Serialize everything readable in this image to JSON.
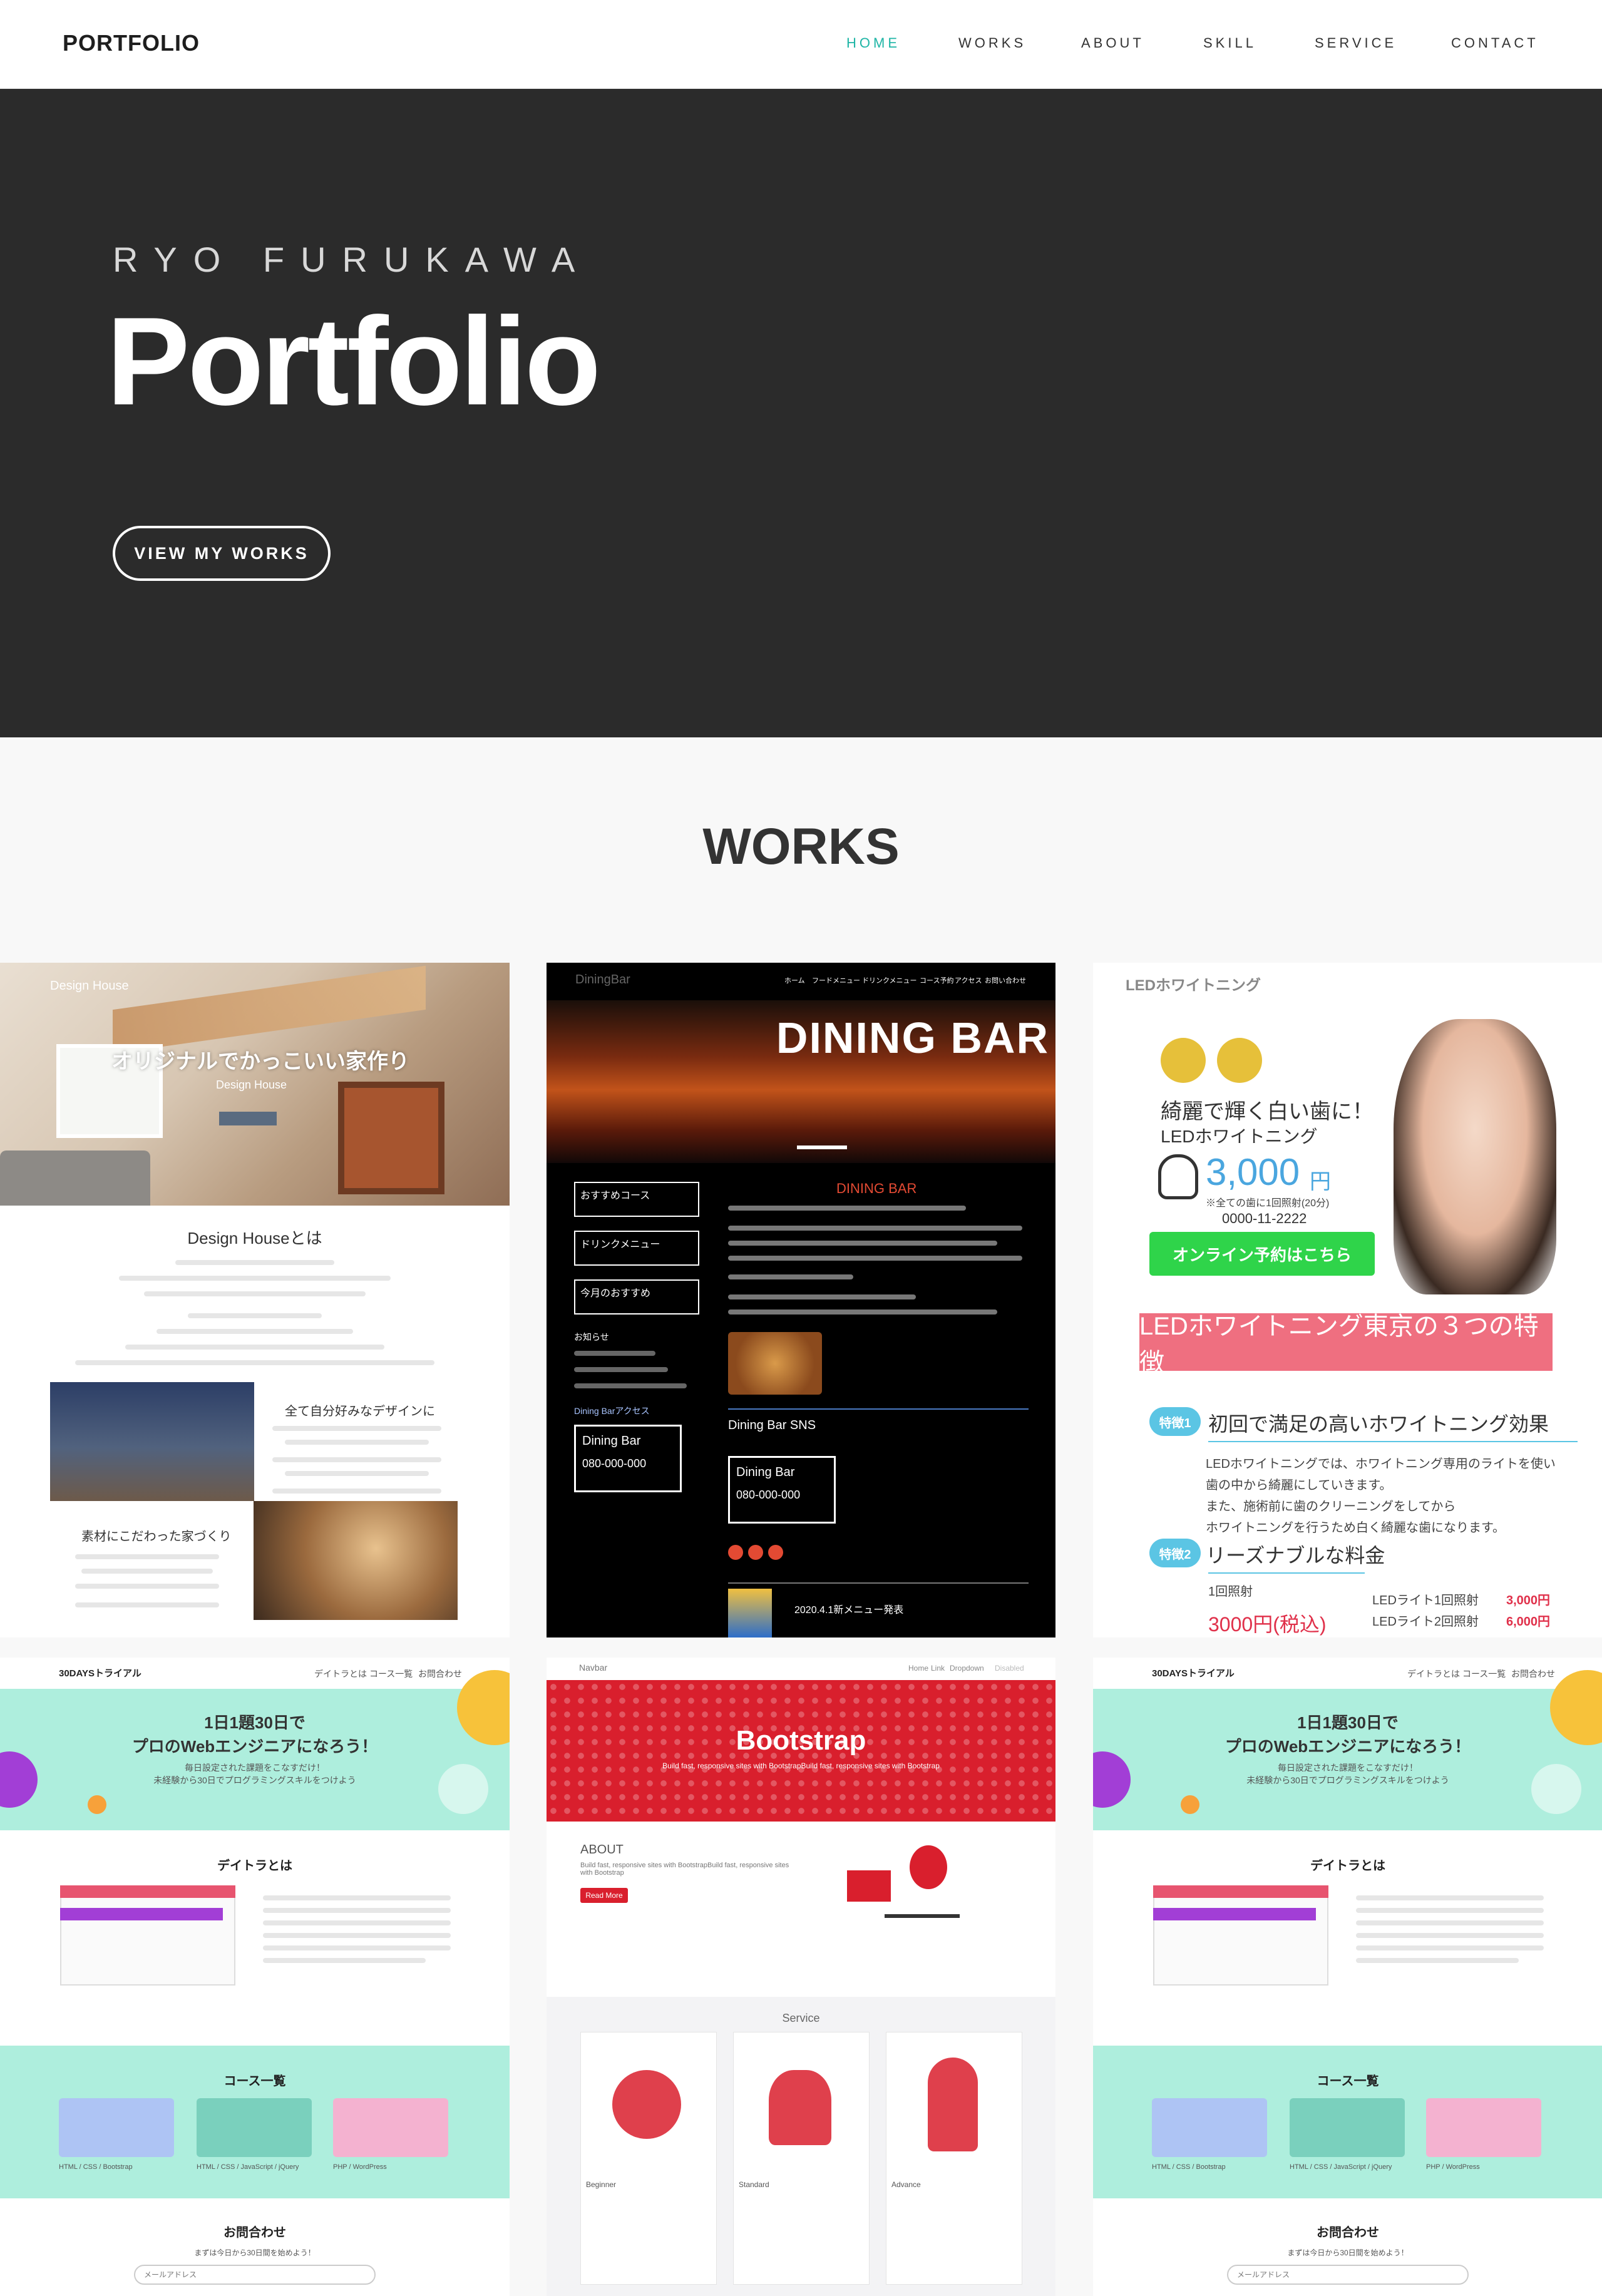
{
  "nav": {
    "brand": "PORTFOLIO",
    "items": [
      {
        "label": "HOME",
        "active": true
      },
      {
        "label": "WORKS"
      },
      {
        "label": "ABOUT"
      },
      {
        "label": "SKILL"
      },
      {
        "label": "SERVICE"
      },
      {
        "label": "CONTACT"
      }
    ]
  },
  "hero": {
    "subtitle": "RYO FURUKAWA",
    "title": "Portfolio",
    "button": "VIEW MY WORKS"
  },
  "works": {
    "title": "WORKS",
    "cards": {
      "design_house": {
        "logo": "Design House",
        "headline": "オリジナルでかっこいい家作り",
        "sub": "Design House",
        "section1": "Design Houseとは",
        "section2": "全て自分好みなデザインに",
        "section3": "素材にこだわった家づくり"
      },
      "dining_bar": {
        "logo": "DiningBar",
        "nav": [
          "ホーム",
          "フードメニュー",
          "ドリンクメニュー",
          "コース予約",
          "アクセス",
          "お問い合わせ"
        ],
        "banner": "DINING BAR",
        "heading": "DINING BAR",
        "side_items": [
          "おすすめコース",
          "ドリンクメニュー",
          "今月のおすすめ"
        ],
        "news_title": "お知らせ",
        "access_title": "Dining Barアクセス",
        "box_name": "Dining Bar",
        "phone": "080-000-000",
        "sns_title": "Dining Bar SNS",
        "sns_box_name": "Dining Bar",
        "sns_phone": "080-000-000",
        "news_item": "2020.4.1新メニュー発表"
      },
      "led": {
        "title": "LEDホワイトニング",
        "catch": "綺麗で輝く白い歯に！",
        "catch2": "LEDホワイトニング",
        "price": "3,000",
        "yen": "円",
        "price_note": "※全ての歯に1回照射(20分)",
        "tel": "0000-11-2222",
        "cta": "オンライン予約はこちら",
        "banner": "LEDホワイトニング東京の３つの特徴",
        "feature1_tag": "特徴1",
        "feature1": "初回で満足の高いホワイトニング効果",
        "feature1_text": [
          "LEDホワイトニングでは、ホワイトニング専用のライトを使い",
          "歯の中から綺麗にしていきます。",
          "また、施術前に歯のクリーニングをしてから",
          "ホワイトニングを行うため白く綺麗な歯になります。"
        ],
        "feature2_tag": "特徴2",
        "feature2": "リーズナブルな料金",
        "row1_left": "1回照射",
        "row1_right": "LEDライト1回照射",
        "row1_price": "3,000円",
        "row2_left": "3000円(税込)",
        "row2_right": "LEDライト2回照射",
        "row2_price": "6,000円"
      },
      "thirty_days": {
        "logo": "30DAYSトライアル",
        "nav": [
          "デイトラとは",
          "コース一覧",
          "お問合わせ"
        ],
        "hero1": "1日1題30日で",
        "hero2": "プロのWebエンジニアになろう！",
        "hero3": "毎日設定された課題をこなすだけ！",
        "hero4": "未経験から30日でプログラミングスキルをつけよう",
        "about": "デイトラとは",
        "courses": "コース一覧",
        "course_labels": [
          "HTML / CSS / Bootstrap",
          "HTML / CSS / JavaScript / jQuery",
          "PHP / WordPress"
        ],
        "contact": "お問合わせ",
        "contact_sub": "まずは今日から30日間を始めよう！",
        "email_placeholder": "メールアドレス"
      },
      "bootstrap": {
        "navbar": "Navbar",
        "nav": [
          "Home",
          "Link",
          "Dropdown",
          "Disabled"
        ],
        "banner": "Bootstrap",
        "banner_sub": "Build fast, responsive sites with BootstrapBuild fast, responsive sites with Bootstrap",
        "about": "ABOUT",
        "about_text": "Build fast, responsive sites with BootstrapBuild fast, responsive sites with Bootstrap",
        "read_more": "Read More",
        "service": "Service",
        "plans": [
          "Beginner",
          "Standard",
          "Advance"
        ]
      }
    }
  },
  "colors": {
    "accent": "#1fb5a6",
    "hero_bg": "#2b2b2b",
    "mint": "#aeeedd",
    "bootstrap_red": "#d91f2d",
    "led_pink": "#ef6f80",
    "led_green": "#2fd44a",
    "dining_red": "#e34a33"
  }
}
